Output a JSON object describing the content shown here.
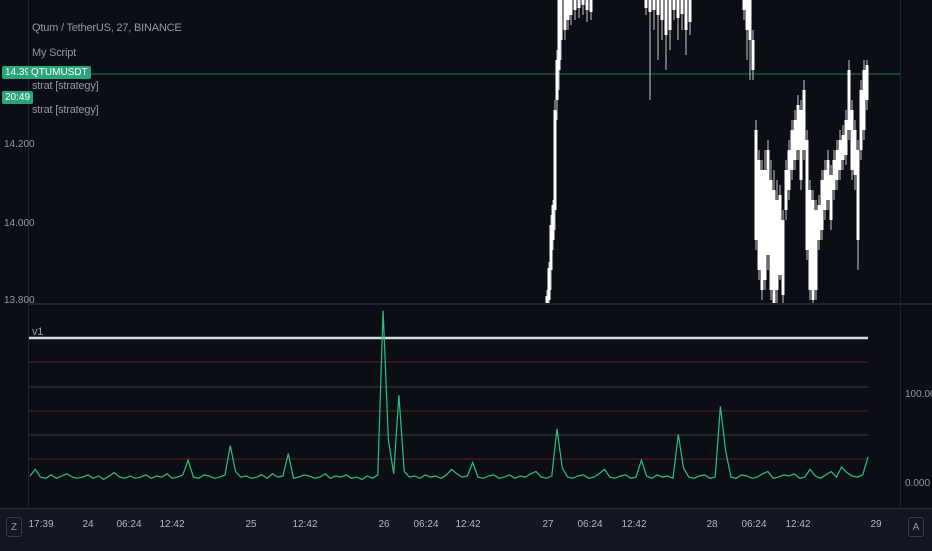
{
  "chart": {
    "symbol_title": "Qtum / TetherUS, 27, BINANCE",
    "script_name": "My Script",
    "legend_items": [
      "strat [strategy]",
      "strat [strategy]"
    ],
    "symbol_badge": "QTUMUSDT",
    "current_price": "14.390",
    "countdown": "20:49",
    "price_ticks": [
      "14.200",
      "14.000",
      "13.800"
    ],
    "indicator_label": "v1",
    "indicator_ticks": [
      "100.000",
      "0.000"
    ],
    "time_ticks": [
      "17:39",
      "24",
      "06:24",
      "12:42",
      "25",
      "12:42",
      "26",
      "06:24",
      "12:42",
      "27",
      "06:24",
      "12:42",
      "28",
      "06:24",
      "12:42",
      "29"
    ],
    "corner_left": "Z",
    "corner_right": "A",
    "colors": {
      "background": "#0c0e15",
      "candle": "#ffffff",
      "price_line": "#2aa57b",
      "indicator_line": "#26c281",
      "ref_gray": "#3c3f47",
      "ref_red": "#5e1f25"
    }
  },
  "chart_data": {
    "type": "line",
    "series": [
      {
        "values": [
          8,
          14,
          7,
          6,
          9,
          6,
          8,
          10,
          7,
          6,
          7,
          9,
          6,
          8,
          5,
          8,
          11,
          7,
          6,
          8,
          6,
          7,
          9,
          6,
          8,
          7,
          10,
          6,
          7,
          9,
          22,
          7,
          6,
          9,
          8,
          6,
          7,
          9,
          35,
          12,
          7,
          8,
          6,
          7,
          9,
          6,
          10,
          7,
          8,
          28,
          6,
          7,
          9,
          8,
          6,
          7,
          10,
          6,
          8,
          7,
          9,
          6,
          7,
          5,
          8,
          6,
          9,
          155,
          40,
          10,
          80,
          12,
          7,
          8,
          6,
          9,
          7,
          8,
          6,
          9,
          14,
          10,
          7,
          8,
          20,
          7,
          6,
          8,
          9,
          6,
          7,
          9,
          6,
          8,
          7,
          10,
          12,
          7,
          6,
          8,
          50,
          15,
          7,
          6,
          8,
          9,
          6,
          7,
          10,
          14,
          7,
          6,
          8,
          9,
          6,
          7,
          22,
          8,
          6,
          9,
          7,
          8,
          6,
          45,
          15,
          7,
          6,
          8,
          9,
          6,
          7,
          70,
          30,
          7,
          6,
          9,
          8,
          6,
          7,
          10,
          12,
          6,
          7,
          9,
          8,
          10,
          6,
          7,
          14,
          8,
          6,
          9,
          12,
          7,
          16,
          11,
          8,
          7,
          9,
          25
        ]
      }
    ]
  }
}
